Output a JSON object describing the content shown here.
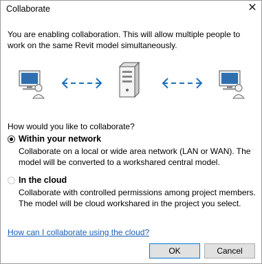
{
  "window": {
    "title": "Collaborate"
  },
  "intro_text": "You are enabling collaboration. This will allow multiple people to work on the same Revit model simultaneously.",
  "illustration": {
    "left_icon": "user-computer-icon",
    "server_icon": "server-icon",
    "right_icon": "user-computer-icon",
    "arrow_icon": "double-arrow-icon",
    "arrow_color": "#1b6fb8"
  },
  "question": "How would you like to collaborate?",
  "options": [
    {
      "title": "Within your network",
      "description": "Collaborate on a local or wide area network (LAN or WAN). The model will be converted to a workshared central model.",
      "selected": true,
      "enabled": true
    },
    {
      "title": "In the cloud",
      "description": "Collaborate with controlled permissions among project members. The model will be cloud workshared in the project you select.",
      "selected": false,
      "enabled": true
    }
  ],
  "help_link": "How can I collaborate using the cloud?",
  "buttons": {
    "ok": "OK",
    "cancel": "Cancel"
  },
  "colors": {
    "link": "#1a5fb4",
    "ok_border": "#0078d7"
  }
}
